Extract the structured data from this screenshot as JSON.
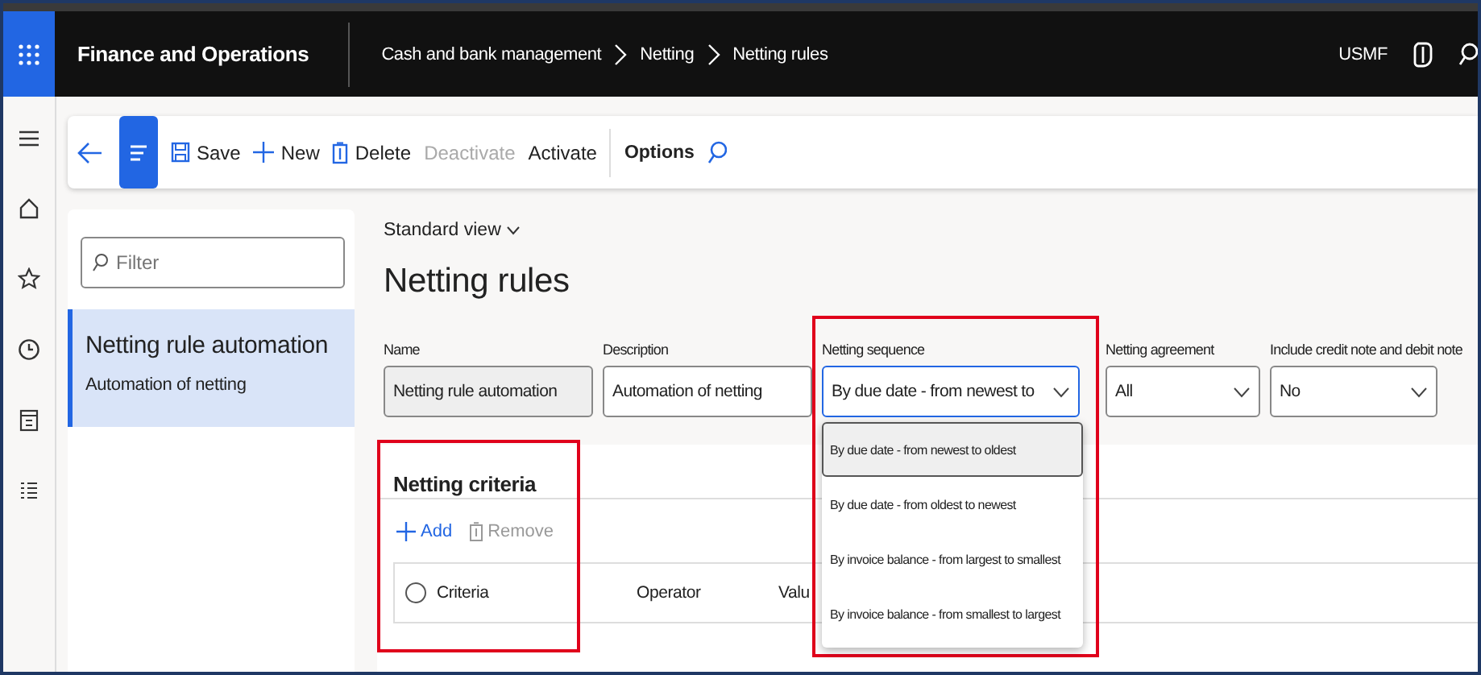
{
  "app_bar": {
    "title": "Finance and Operations",
    "breadcrumb": [
      "Cash and bank management",
      "Netting",
      "Netting rules"
    ],
    "company": "USMF"
  },
  "toolbar": [
    {
      "kind": "back"
    },
    {
      "kind": "menu"
    },
    {
      "kind": "save",
      "label": "Save",
      "disabled": false
    },
    {
      "kind": "new",
      "label": "New",
      "disabled": false
    },
    {
      "kind": "delete",
      "label": "Delete",
      "disabled": false
    },
    {
      "kind": "action",
      "label": "Deactivate",
      "disabled": true
    },
    {
      "kind": "action",
      "label": "Activate",
      "disabled": false
    },
    {
      "kind": "separator"
    },
    {
      "kind": "strong",
      "label": "Options"
    },
    {
      "kind": "search"
    }
  ],
  "list_pane": {
    "filter": {
      "placeholder": "Filter"
    },
    "items": [
      {
        "title": "Netting rule automation",
        "subtitle": "Automation of netting",
        "selected": true
      }
    ]
  },
  "view": "Standard view",
  "page_title": "Netting rules",
  "fields": [
    {
      "kind": "text",
      "label": "Name",
      "value": "Netting rule automation",
      "disabled": true
    },
    {
      "kind": "text",
      "label": "Description",
      "value": "Automation of netting",
      "disabled": false
    },
    {
      "kind": "select",
      "label": "Netting sequence",
      "value": "By due date - from newest to",
      "focused": true
    },
    {
      "kind": "select",
      "label": "Netting agreement",
      "value": "All",
      "focused": false
    },
    {
      "kind": "select",
      "label": "Include credit note and debit note",
      "value": "No",
      "focused": false
    }
  ],
  "dropdown": [
    {
      "label": "By due date - from newest to oldest",
      "selected": true
    },
    {
      "label": "By due date - from oldest to newest",
      "selected": false
    },
    {
      "label": "By invoice balance - from largest to smallest",
      "selected": false
    },
    {
      "label": "By invoice balance - from smallest to largest",
      "selected": false
    }
  ],
  "criteria": {
    "title": "Netting criteria",
    "actions": [
      {
        "kind": "add",
        "label": "Add",
        "disabled": false
      },
      {
        "kind": "remove",
        "label": "Remove",
        "disabled": true
      }
    ],
    "select_all": {
      "checked": false
    },
    "columns": [
      "Criteria",
      "Operator",
      "Valu"
    ]
  }
}
